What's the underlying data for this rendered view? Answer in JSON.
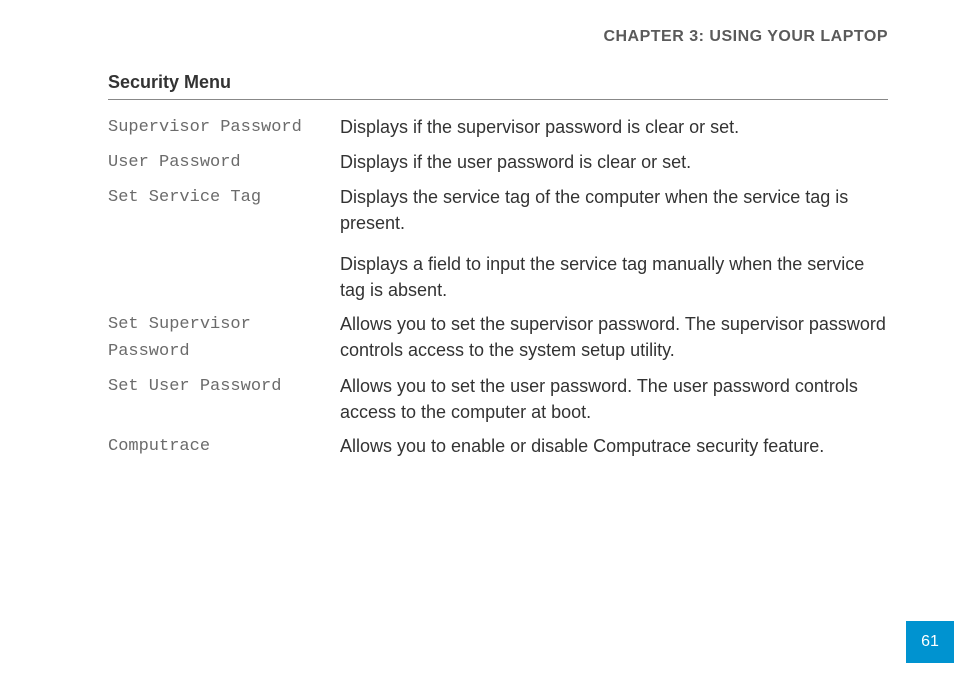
{
  "chapter_header": "CHAPTER 3: USING YOUR LAPTOP",
  "section_title": "Security Menu",
  "rows": [
    {
      "term": "Supervisor Password",
      "desc": [
        "Displays if the supervisor password is clear or set."
      ]
    },
    {
      "term": "User Password",
      "desc": [
        "Displays if the user password is clear or set."
      ]
    },
    {
      "term": "Set Service Tag",
      "desc": [
        "Displays the service tag of the computer when the service tag is present.",
        "Displays a field to input the service tag manually when the service tag is absent."
      ]
    },
    {
      "term": "Set Supervisor Password",
      "desc": [
        "Allows you to set the supervisor password. The supervisor password controls access to the system setup utility."
      ]
    },
    {
      "term": "Set User Password",
      "desc": [
        "Allows you to set the user password. The user password controls access to the computer at boot."
      ]
    },
    {
      "term": "Computrace",
      "desc": [
        "Allows you to enable or disable Computrace security feature."
      ]
    }
  ],
  "page_number": "61"
}
